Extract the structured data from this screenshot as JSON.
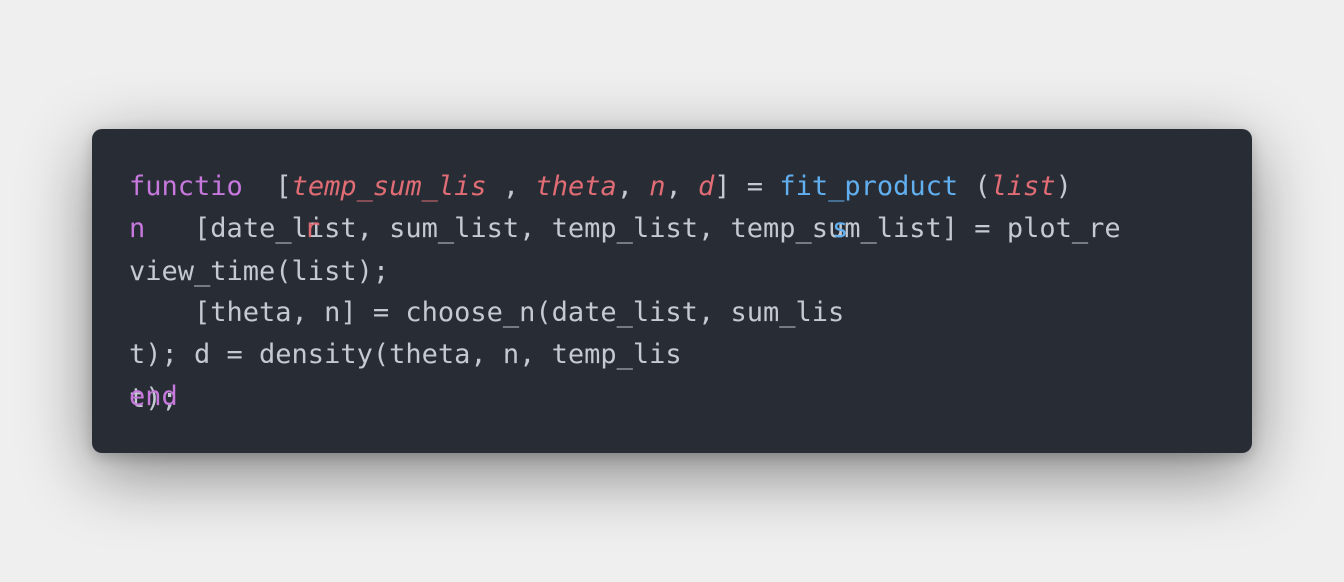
{
  "code": {
    "line1": {
      "keyword": "functio",
      "open": "[",
      "out1": "temp_sum_lis",
      "sep1": " , ",
      "out2": "theta",
      "sep2": ", ",
      "out3": "n",
      "sep3": ", ",
      "out4": "d",
      "close": "] = ",
      "fname": "fit_product",
      "paren_open": " (",
      "arg": "list",
      "paren_close": ")"
    },
    "line2": {
      "keyword_n": "n",
      "text": "[date_list, sum_list, temp_list, temp_sum_list] = plot_re",
      "stray_r": "r",
      "stray_s": "s"
    },
    "line3": "view_time(list);",
    "line4": "    [theta, n] = choose_n(date_list, sum_lis",
    "line5": "t); d = density(theta, n, temp_lis",
    "line6_text": "t);",
    "line6_keyword": "end"
  },
  "colors": {
    "background": "#efefef",
    "editor": "#282c34",
    "text": "#c4c9d2",
    "keyword": "#c678dd",
    "variable": "#e06c75",
    "function": "#61afef"
  }
}
